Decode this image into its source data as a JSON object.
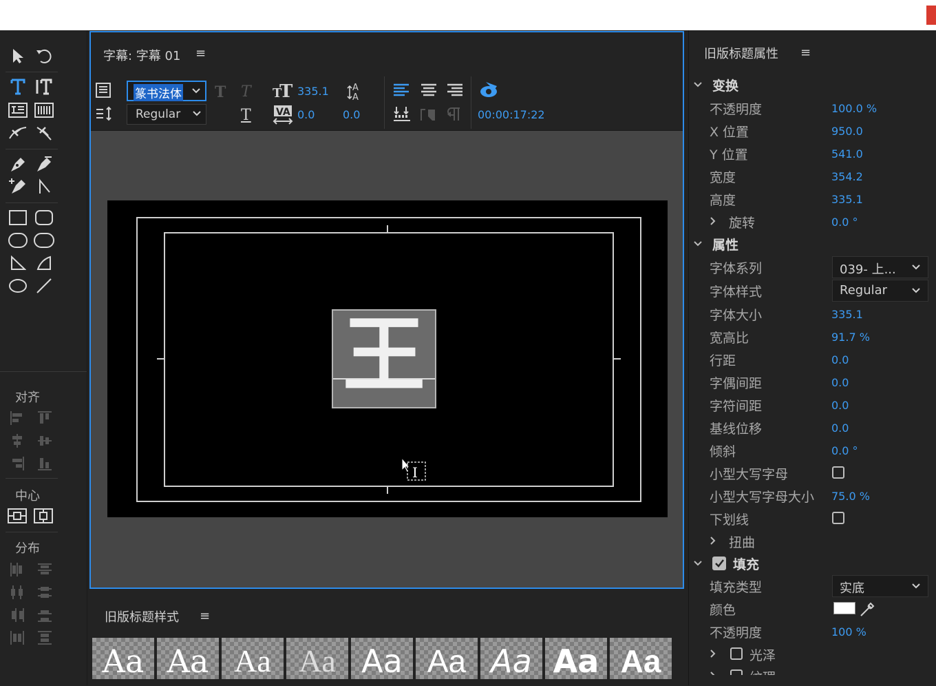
{
  "titler": {
    "title": "字幕: 字幕 01",
    "menu_icon": "≡",
    "font_family_value": "篆书法体",
    "font_style_value": "Regular",
    "font_size": "335.1",
    "kerning": "0.0",
    "leading": "0.0",
    "timecode": "00:00:17:22",
    "canvas_glyph": "王"
  },
  "tools": {
    "align_label": "对齐",
    "center_label": "中心",
    "distribute_label": "分布"
  },
  "styles_panel": {
    "title": "旧版标题样式",
    "menu_icon": "≡",
    "swatches": [
      "Aa",
      "Aa",
      "Aa",
      "Aa",
      "Aa",
      "Aa",
      "Aa",
      "Aa",
      "Aa"
    ]
  },
  "props": {
    "title": "旧版标题属性",
    "menu_icon": "≡",
    "transform": {
      "label": "变换",
      "opacity_label": "不透明度",
      "opacity": "100.0 %",
      "x_label": "X 位置",
      "x": "950.0",
      "y_label": "Y 位置",
      "y": "541.0",
      "width_label": "宽度",
      "width": "354.2",
      "height_label": "高度",
      "height": "335.1",
      "rotation_label": "旋转",
      "rotation": "0.0 °"
    },
    "properties": {
      "label": "属性",
      "font_family_label": "字体系列",
      "font_family": "039- 上...",
      "font_style_label": "字体样式",
      "font_style": "Regular",
      "font_size_label": "字体大小",
      "font_size": "335.1",
      "aspect_label": "宽高比",
      "aspect": "91.7 %",
      "leading_label": "行距",
      "leading": "0.0",
      "kerning_label": "字偶间距",
      "kerning": "0.0",
      "tracking_label": "字符间距",
      "tracking": "0.0",
      "baseline_label": "基线位移",
      "baseline": "0.0",
      "slant_label": "倾斜",
      "slant": "0.0 °",
      "small_caps_label": "小型大写字母",
      "small_caps_size_label": "小型大写字母大小",
      "small_caps_size": "75.0 %",
      "underline_label": "下划线",
      "distort_label": "扭曲"
    },
    "fill": {
      "label": "填充",
      "fill_type_label": "填充类型",
      "fill_type": "实底",
      "color_label": "颜色",
      "color": "#ffffff",
      "opacity_label": "不透明度",
      "opacity": "100 %",
      "sheen_label": "光泽",
      "texture_label": "纹理"
    }
  }
}
